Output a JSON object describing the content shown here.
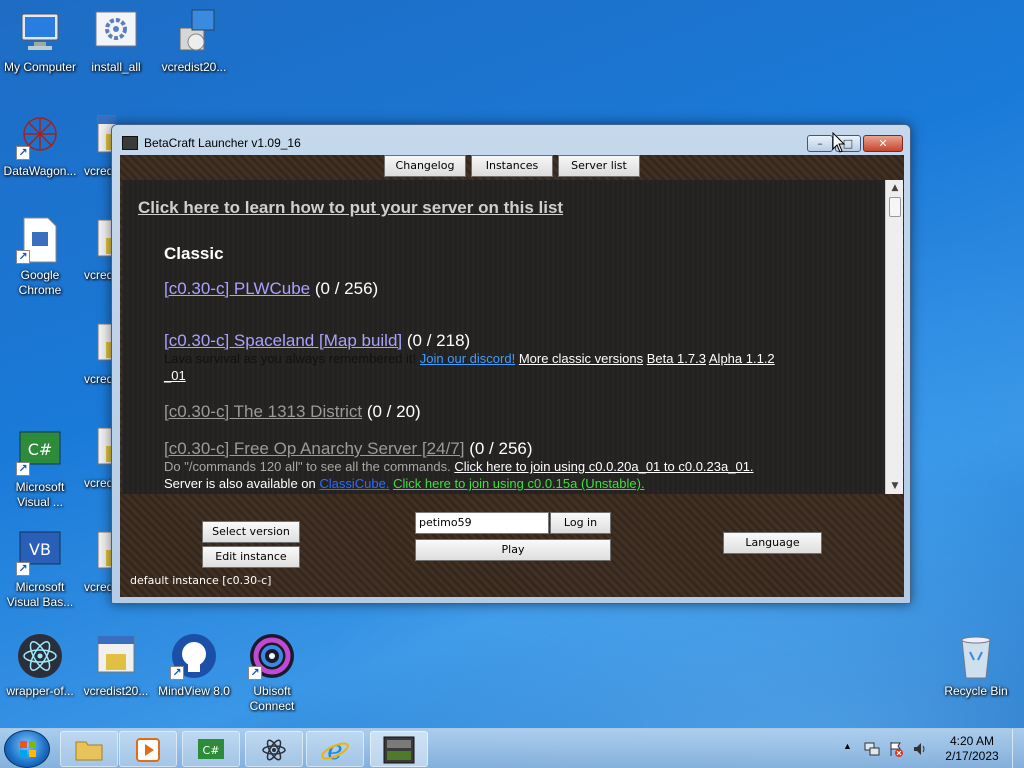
{
  "desktop": {
    "icons": [
      {
        "label": "My Computer"
      },
      {
        "label": "install_all"
      },
      {
        "label": "vcredist20..."
      },
      {
        "label": "DataWagon..."
      },
      {
        "label": "vcred"
      },
      {
        "label": "Google Chrome"
      },
      {
        "label": "vcred"
      },
      {
        "label": "vcred"
      },
      {
        "label": "Microsoft Visual ..."
      },
      {
        "label": "vcred"
      },
      {
        "label": "Microsoft Visual Bas..."
      },
      {
        "label": "vcred"
      },
      {
        "label": "wrapper-of..."
      },
      {
        "label": "vcredist20..."
      },
      {
        "label": "MindView 8.0"
      },
      {
        "label": "Ubisoft Connect"
      },
      {
        "label": "Recycle Bin"
      }
    ]
  },
  "window": {
    "title": "BetaCraft Launcher v1.09_16",
    "controls": {
      "minimize": "–",
      "maximize": "□",
      "close": "✕"
    },
    "tabs": [
      "Changelog",
      "Instances",
      "Server list"
    ],
    "server_list": {
      "header_link": "Click here to learn how to put your server on this list",
      "section_title": "Classic",
      "servers": [
        {
          "name": "[c0.30-c] PLWCube",
          "players": "(0 / 256)"
        },
        {
          "name": "[c0.30-c] Spaceland [Map build]",
          "players": "(0 / 218)"
        },
        {
          "name": "[c0.30-c] The 1313 District",
          "players": "(0 / 20)"
        },
        {
          "name": "[c0.30-c] Free Op Anarchy Server [24/7]",
          "players": "(0 / 256)"
        }
      ],
      "spaceland_desc": {
        "text": "Lava survival as you always remembered it!",
        "discord": "Join our discord!",
        "more": "More classic versions",
        "beta": "Beta 1.7.3",
        "alpha": "Alpha 1.1.2",
        "alpha_suffix": "_01"
      },
      "anarchy_desc": {
        "text": "Do \"/commands 120 all\" to see all the commands.",
        "join1": "Click here to join using c0.0.20a_01 to c0.0.23a_01.",
        "also": "Server is also available on",
        "classicube": "ClassiCube.",
        "join2": "Click here to join using c0.0.15a (Unstable)."
      }
    },
    "bottom": {
      "select_version": "Select version",
      "edit_instance": "Edit instance",
      "username_value": "petimo59",
      "login": "Log in",
      "play": "Play",
      "language": "Language",
      "status": "default instance [c0.30-c]"
    }
  },
  "taskbar": {
    "items": [
      "Explorer",
      "Media Player",
      "Visual C#",
      "Electron app",
      "Internet Explorer",
      "BetaCraft"
    ],
    "clock_time": "4:20 AM",
    "clock_date": "2/17/2023"
  },
  "colors": {
    "link_purple": "#a9a2ff",
    "link_blue": "#3e9cff",
    "link_green": "#3ce23c",
    "panel_bg": "#242220"
  }
}
